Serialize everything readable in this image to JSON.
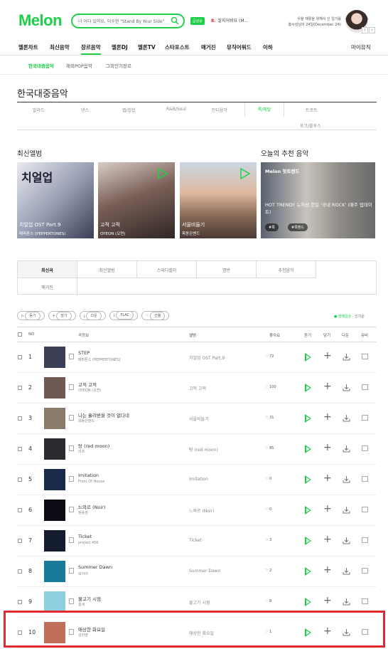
{
  "header": {
    "logo": "Melon",
    "search_placeholder": "너 어디 있어요, 이수현 \"Stand By Your Side\"",
    "badge": "급상승",
    "live_rank": {
      "number": "8.",
      "title": "잘지어봐요 (M..."
    },
    "promo": "우울 재활을 위해서 인 일기를\n홍사성님의 24일(December. 24)",
    "nav_prev": "‹",
    "nav_next": "›"
  },
  "gnb": [
    "멜론차트",
    "최신음악",
    "장르음악",
    "멜론DJ",
    "멜론TV",
    "스타포스트",
    "매거진",
    "뮤직어워드",
    "이하"
  ],
  "gnb_right": "마이뮤직",
  "subnav": [
    "한국대중음악",
    "해외POP음악",
    "그외인기장르"
  ],
  "page_title": "한국대중음악",
  "genres": [
    "발라드",
    "댄스",
    "랩/힙합",
    "R&B/Soul",
    "인디음악",
    "록/메탈",
    "트로트",
    "포크/블루스"
  ],
  "section_new": "최신앨범",
  "section_rec": "오늘의 추천 음악",
  "albums": [
    {
      "title": "치얼업 OST Part.9",
      "artist": "페퍼톤스 (PEPPERTONES)",
      "art_text": "치얼업"
    },
    {
      "title": "고적 고적",
      "artist": "OYEON (오연)"
    },
    {
      "title": "서울비들기",
      "artist": "목동은밴드"
    }
  ],
  "recommend": {
    "head": "Melon 핫트렌드",
    "desc": "HOT TRENDY 뉴처선 한일 '국내 ROCK' (매주 업데이트)",
    "tags": [
      "#록",
      "#록밴드"
    ]
  },
  "tabs": [
    "최신곡",
    "최신앨범",
    "스테디셀러",
    "명반",
    "추천음악",
    "매거진"
  ],
  "actions": [
    "듣기",
    "담기",
    "다운",
    "FLAC",
    "선물"
  ],
  "sort": {
    "active": "발매일순",
    "other": "인기순"
  },
  "columns": [
    "NO",
    "곡정보",
    "앨범",
    "좋아요",
    "듣기",
    "담기",
    "다운",
    "뮤비"
  ],
  "songs": [
    {
      "no": "1",
      "title": "STEP",
      "artist": "페퍼톤스 (PEPPERTONES)",
      "album": "치얼업 OST Part.9",
      "likes": "72",
      "thumb": "#3a3f55"
    },
    {
      "no": "2",
      "title": "고적 고적",
      "artist": "OYEON (오연)",
      "album": "고적 고적",
      "likes": "100",
      "thumb": "#6e5a52"
    },
    {
      "no": "3",
      "title": "나는 흘려받을 것이 없다네",
      "artist": "목동은밴드",
      "album": "서울비들기",
      "likes": "31",
      "thumb": "#8a7a6a"
    },
    {
      "no": "4",
      "title": "탕 (red moon)",
      "artist": "미조",
      "album": "탕 (red moon)",
      "likes": "85",
      "thumb": "#2c2a30"
    },
    {
      "no": "5",
      "title": "Imitation",
      "artist": "Front Of House",
      "album": "Imitation",
      "likes": "0",
      "thumb": "#1a2a4a"
    },
    {
      "no": "6",
      "title": "느와르 (Noir)",
      "artist": "정용권",
      "album": "느와르 (Noir)",
      "likes": "0",
      "thumb": "#0c0c14"
    },
    {
      "no": "7",
      "title": "Ticket",
      "artist": "project 456",
      "album": "Ticket",
      "likes": "3",
      "thumb": "#141c30"
    },
    {
      "no": "8",
      "title": "Summer Dawn",
      "artist": "보이어",
      "album": "Summer Dawn",
      "likes": "2",
      "thumb": "#1a7a9a"
    },
    {
      "no": "9",
      "title": "물고기 시점",
      "artist": "홍세",
      "album": "물고기 시점",
      "likes": "8",
      "thumb": "#8ed0e0"
    },
    {
      "no": "10",
      "title": "애상한 화요일",
      "artist": "김라영",
      "album": "애상한 화요일",
      "likes": "1",
      "thumb": "#c0705a"
    }
  ],
  "colors": {
    "brand": "#1fcf49",
    "highlight": "#e0282e"
  }
}
